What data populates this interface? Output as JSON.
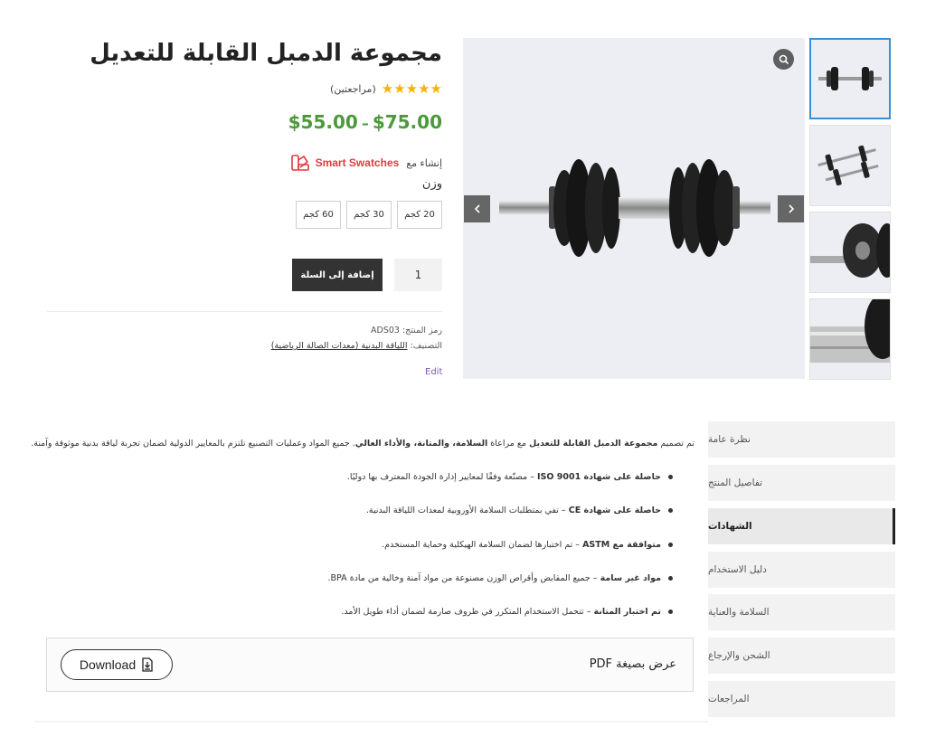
{
  "product": {
    "title": "مجموعة الدمبل القابلة للتعديل",
    "reviews_text": "(مراجعتين)",
    "stars": "★★★★★",
    "rating": 5,
    "price_min": "$55.00",
    "price_sep": "–",
    "price_max": "$75.00",
    "powered_by": "إنشاء مع",
    "swatch_brand": "Smart Swatches",
    "weight_label": "وزن",
    "swatches": [
      "20 كجم",
      "30 كجم",
      "60 كجم"
    ],
    "quantity": "1",
    "add_to_cart": "إضافة إلى السلة",
    "sku_label": "رمز المنتج:",
    "sku": "ADS03",
    "category_label": "التصنيف:",
    "category": "اللياقة البدنية (معدات الصالة الرياضية)",
    "edit": "Edit"
  },
  "gallery": {
    "icons": {
      "zoom": "search-icon",
      "prev": "chevron-left-icon",
      "next": "chevron-right-icon"
    }
  },
  "tabs": [
    {
      "label": "نظرة عامة"
    },
    {
      "label": "تفاصيل المنتج"
    },
    {
      "label": "الشهادات"
    },
    {
      "label": "دليل الاستخدام"
    },
    {
      "label": "السلامة والعناية"
    },
    {
      "label": "الشحن والإرجاع"
    },
    {
      "label": "المراجعات"
    }
  ],
  "active_tab": "الشهادات",
  "certifications": {
    "intro_pre": "تم تصميم ",
    "intro_bold1": "مجموعة الدمبل القابلة للتعديل",
    "intro_mid": " مع مراعاة ",
    "intro_bold2": "السلامة، والمتانة، والأداء العالي",
    "intro_post": ". جميع المواد وعمليات التصنيع تلتزم بالمعايير الدولية لضمان تجربة لياقة بدنية موثوقة وآمنة.",
    "items": [
      {
        "bold": "حاصلة على شهادة ISO 9001",
        "text": " – مصنّعة وفقًا لمعايير إدارة الجودة المعترف بها دوليًا."
      },
      {
        "bold": "حاصلة على شهادة CE",
        "text": " – تفي بمتطلبات السلامة الأوروبية لمعدات اللياقة البدنية."
      },
      {
        "bold": "متوافقة مع ASTM",
        "text": " – تم اختبارها لضمان السلامة الهيكلية وحماية المستخدم."
      },
      {
        "bold": "مواد غير سامة",
        "text": " – جميع المقابض وأقراص الوزن مصنوعة من مواد آمنة وخالية من مادة BPA."
      },
      {
        "bold": "تم اختبار المتانة",
        "text": " – تتحمل الاستخدام المتكرر في ظروف صارمة لضمان أداء طويل الأمد."
      }
    ],
    "pdf_label": "عرض بصيغة PDF",
    "download": "Download"
  }
}
